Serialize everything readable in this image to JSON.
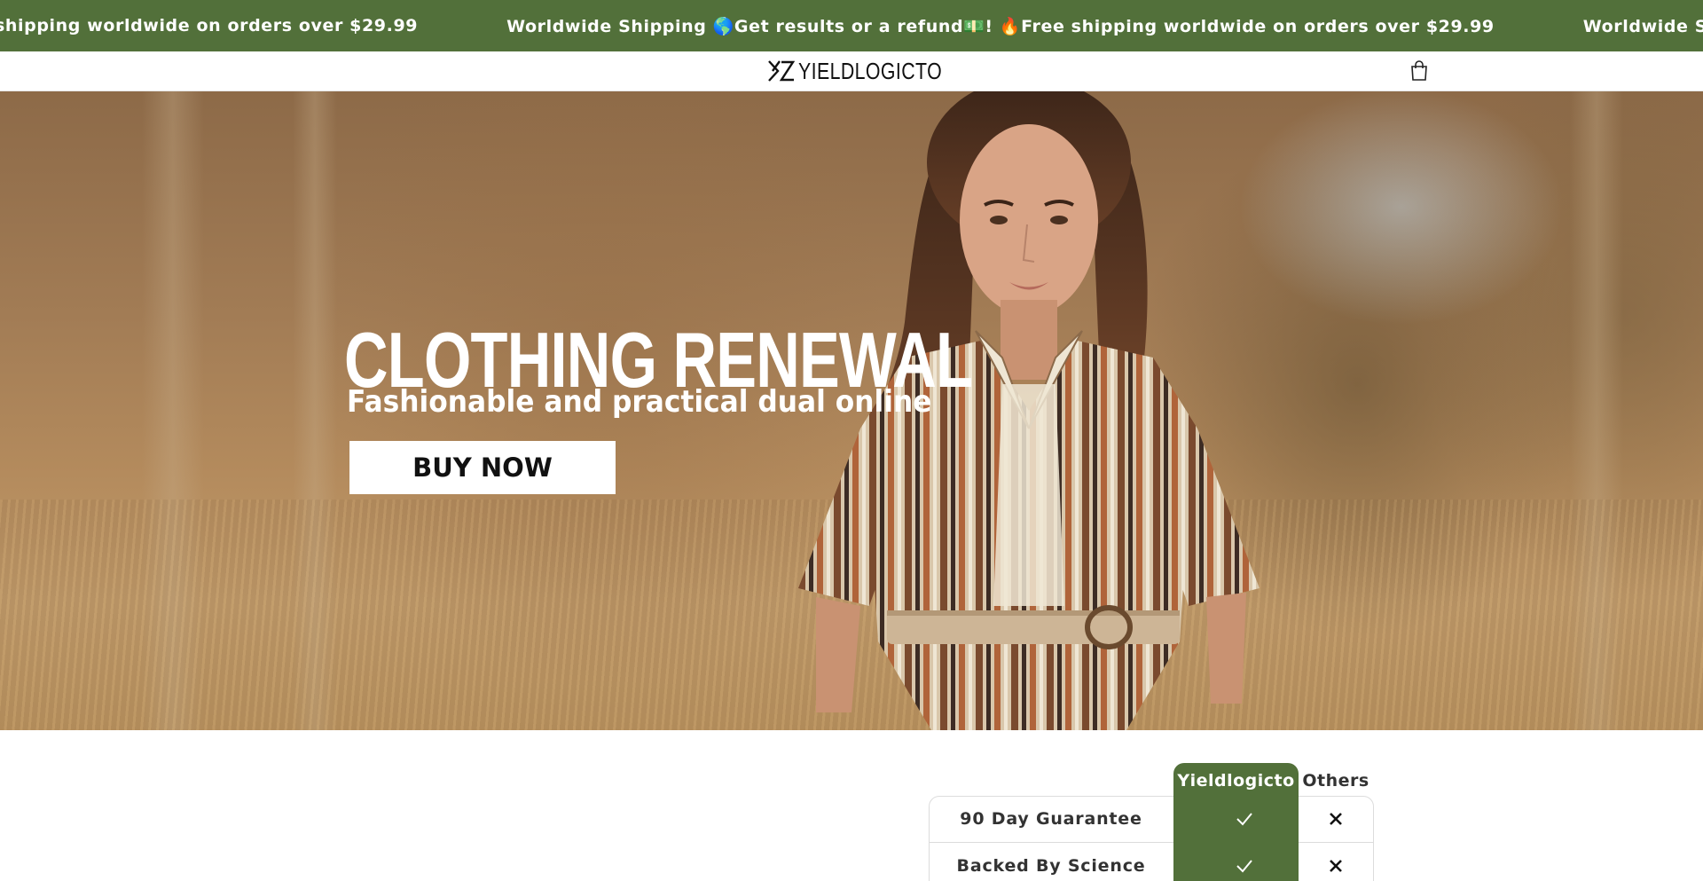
{
  "announcement": {
    "items": [
      "shipping worldwide on orders over $29.99",
      "Worldwide Shipping 🌎Get results or a refund💵! 🔥Free shipping worldwide on orders over $29.99",
      "Worldwide Shipping 🌎Get resu"
    ],
    "background": "#52703a"
  },
  "header": {
    "logo_text": "YIELDLOGICTO",
    "cart_icon": "shopping-bag-icon"
  },
  "hero": {
    "title": "CLOTHING RENEWAL",
    "subtitle": "Fashionable and practical dual online",
    "button_label": "BUY NOW"
  },
  "comparison": {
    "brand_header": "Yieldlogicto",
    "others_header": "Others",
    "rows": [
      {
        "label": "90 Day Guarantee",
        "brand": "check-icon",
        "others": "close-icon"
      },
      {
        "label": "Backed By Science",
        "brand": "check-icon",
        "others": "close-icon"
      }
    ],
    "accent": "#52703a"
  }
}
